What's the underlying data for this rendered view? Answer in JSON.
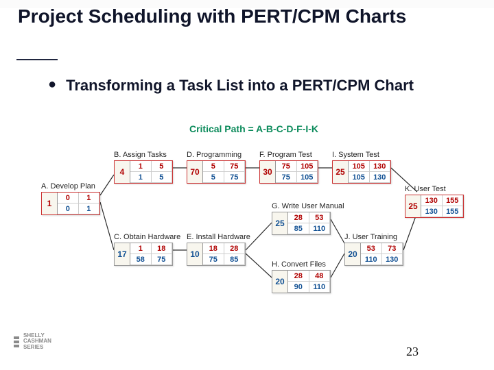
{
  "title": "Project Scheduling with PERT/CPM Charts",
  "bullet": "Transforming a Task List into a PERT/CPM Chart",
  "critical_path": "Critical Path = A-B-C-D-F-I-K",
  "page_number": "23",
  "logo": {
    "l1": "SHELLY",
    "l2": "CASHMAN",
    "l3": "SERIES"
  },
  "tasks": {
    "A": {
      "label": "A. Develop Plan",
      "dur": "1",
      "es": "0",
      "ef": "1",
      "ls": "0",
      "lf": "1",
      "red": true
    },
    "B": {
      "label": "B. Assign Tasks",
      "dur": "4",
      "es": "1",
      "ef": "5",
      "ls": "1",
      "lf": "5",
      "red": true
    },
    "C": {
      "label": "C. Obtain Hardware",
      "dur": "17",
      "es": "1",
      "ef": "18",
      "ls": "58",
      "lf": "75",
      "red": false
    },
    "D": {
      "label": "D. Programming",
      "dur": "70",
      "es": "5",
      "ef": "75",
      "ls": "5",
      "lf": "75",
      "red": true
    },
    "E": {
      "label": "E. Install Hardware",
      "dur": "10",
      "es": "18",
      "ef": "28",
      "ls": "75",
      "lf": "85",
      "red": false
    },
    "F": {
      "label": "F. Program Test",
      "dur": "30",
      "es": "75",
      "ef": "105",
      "ls": "75",
      "lf": "105",
      "red": true
    },
    "G": {
      "label": "G. Write User Manual",
      "dur": "25",
      "es": "28",
      "ef": "53",
      "ls": "85",
      "lf": "110",
      "red": false
    },
    "H": {
      "label": "H. Convert Files",
      "dur": "20",
      "es": "28",
      "ef": "48",
      "ls": "90",
      "lf": "110",
      "red": false
    },
    "I": {
      "label": "I. System Test",
      "dur": "25",
      "es": "105",
      "ef": "130",
      "ls": "105",
      "lf": "130",
      "red": true
    },
    "J": {
      "label": "J. User Training",
      "dur": "20",
      "es": "53",
      "ef": "73",
      "ls": "110",
      "lf": "130",
      "red": false
    },
    "K": {
      "label": "K. User Test",
      "dur": "25",
      "es": "130",
      "ef": "155",
      "ls": "130",
      "lf": "155",
      "red": true
    }
  }
}
